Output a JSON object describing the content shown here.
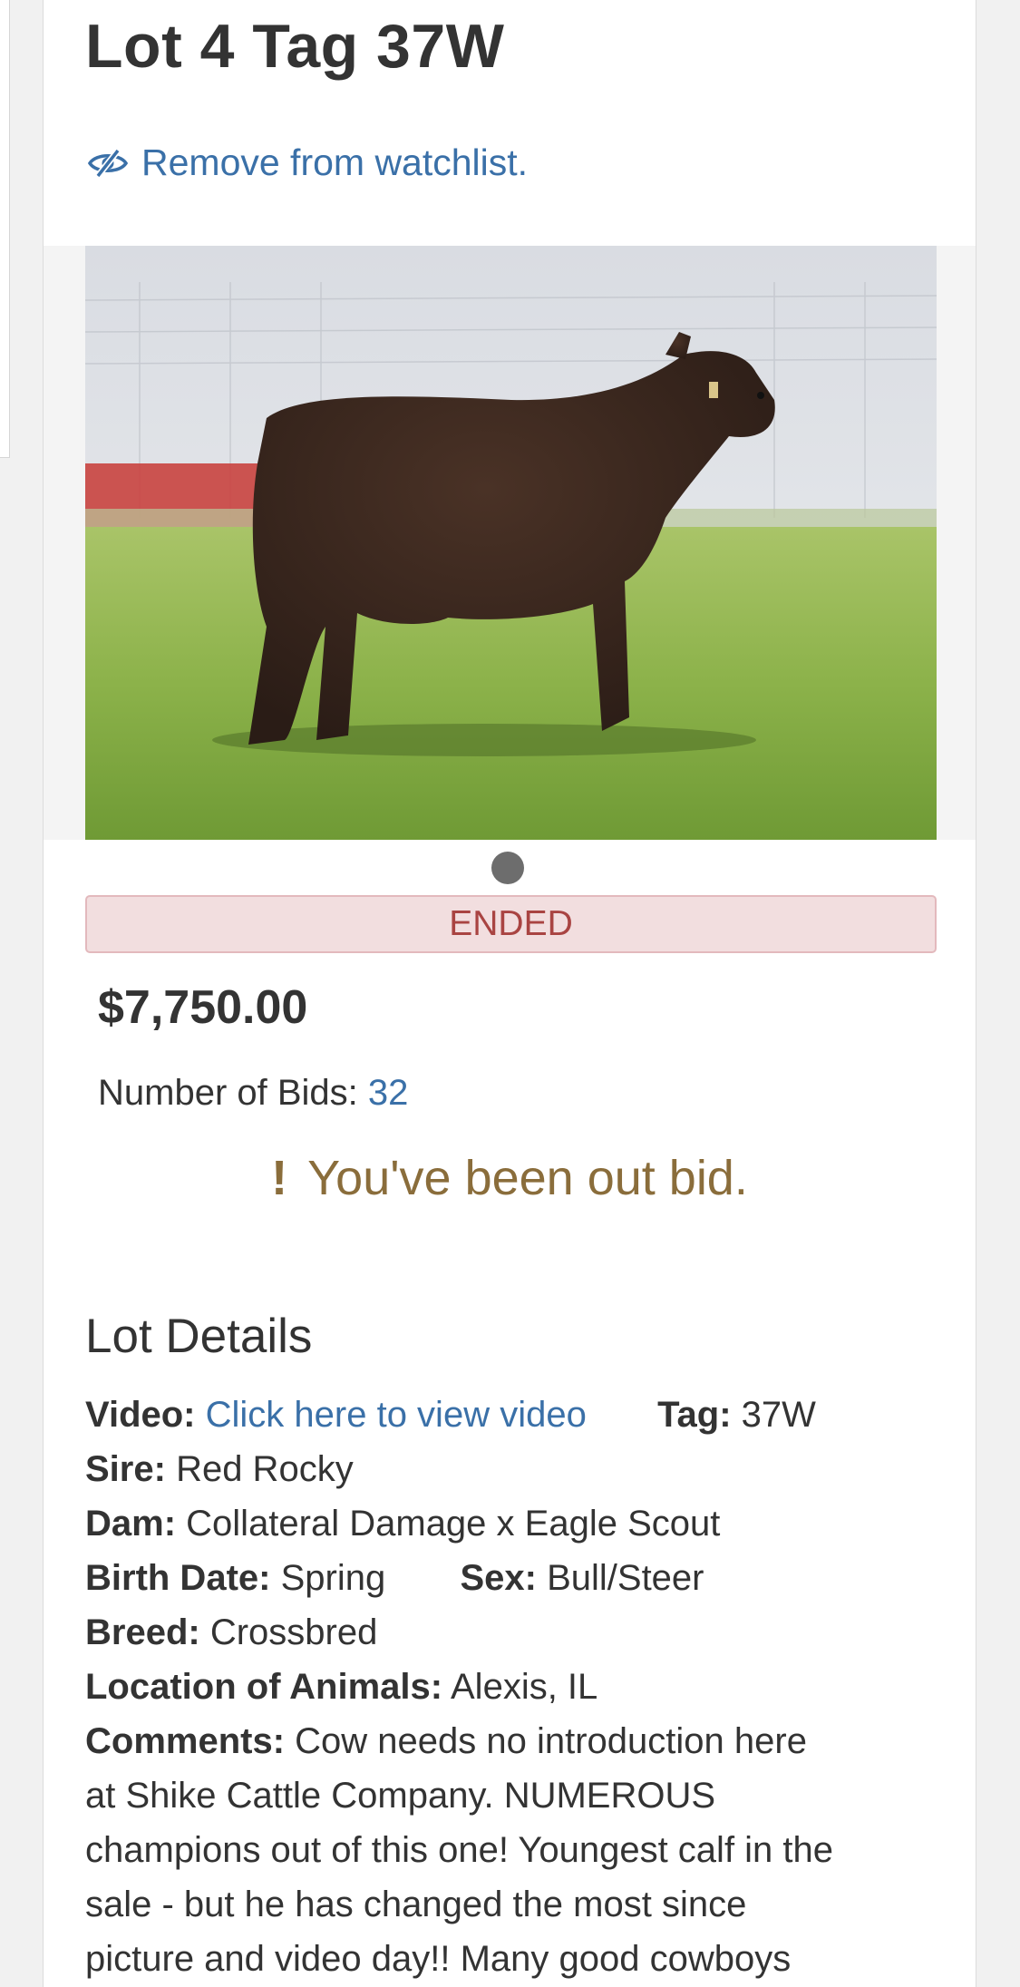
{
  "lot": {
    "title": "Lot 4 Tag 37W",
    "watchlist_label": "Remove from watchlist.",
    "watchlist_icon": "eye-slash-icon"
  },
  "carousel": {
    "image_alt": "Black crossbred steer calf standing in profile on green grass",
    "dots": 1,
    "active_dot": 1
  },
  "auction": {
    "status": "ENDED",
    "price": "$7,750.00",
    "bids_label": "Number of Bids:",
    "bids_count": "32",
    "alert_icon": "exclamation-icon",
    "alert_text": "You've been out bid."
  },
  "details": {
    "heading": "Lot Details",
    "video_label": "Video:",
    "video_link": "Click here to view video",
    "tag_label": "Tag:",
    "tag_value": "37W",
    "sire_label": "Sire:",
    "sire_value": "Red Rocky",
    "dam_label": "Dam:",
    "dam_value": "Collateral Damage x Eagle Scout",
    "birth_label": "Birth Date:",
    "birth_value": "Spring",
    "sex_label": "Sex:",
    "sex_value": "Bull/Steer",
    "breed_label": "Breed:",
    "breed_value": "Crossbred",
    "location_label": "Location of Animals:",
    "location_value": "Alexis, IL",
    "comments_label": "Comments:",
    "comments_lines": [
      "Cow needs no introduction here",
      "at Shike Cattle Company. NUMEROUS",
      "champions out of this one! Youngest calf in the",
      "sale - but he has changed the most since",
      "picture and video day!! Many good cowboys"
    ]
  },
  "colors": {
    "link": "#3a70a8",
    "danger_text": "#a94442",
    "danger_bg": "#f2dedf",
    "warning_text": "#8a6d3b"
  }
}
